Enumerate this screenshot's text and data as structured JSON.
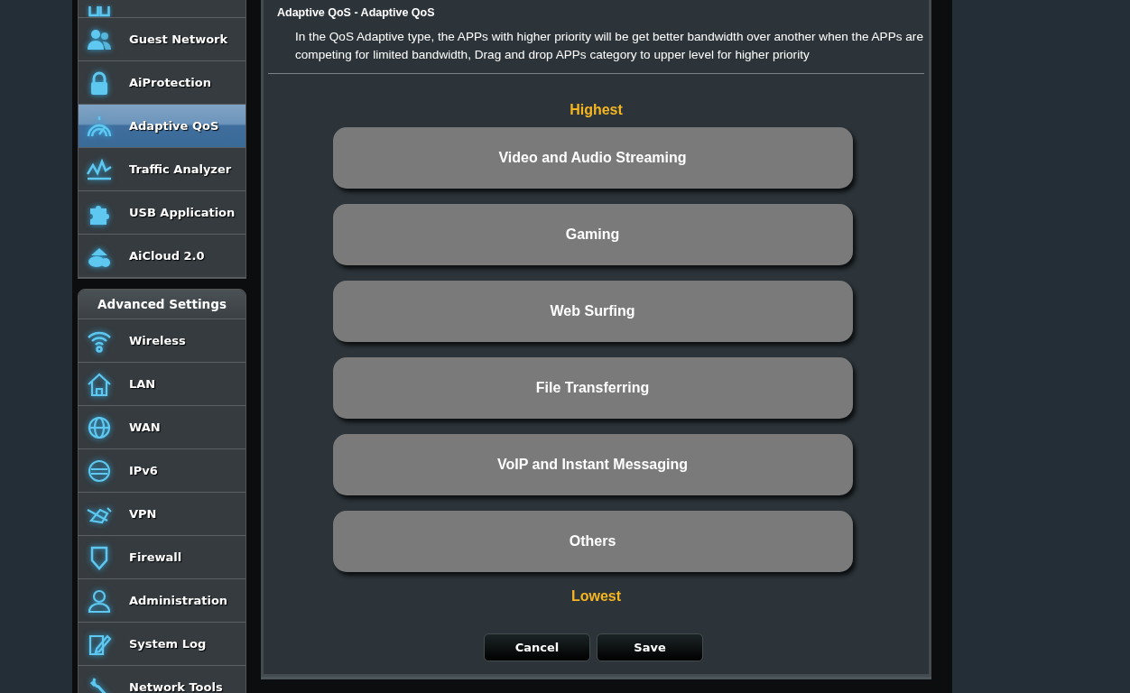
{
  "sidebar": {
    "general_items": [
      {
        "label": "Guest Network",
        "selected": false
      },
      {
        "label": "AiProtection",
        "selected": false
      },
      {
        "label": "Adaptive QoS",
        "selected": true
      },
      {
        "label": "Traffic Analyzer",
        "selected": false
      },
      {
        "label": "USB Application",
        "selected": false
      },
      {
        "label": "AiCloud 2.0",
        "selected": false
      }
    ],
    "advanced_header": "Advanced Settings",
    "advanced_items": [
      {
        "label": "Wireless",
        "selected": false
      },
      {
        "label": "LAN",
        "selected": false
      },
      {
        "label": "WAN",
        "selected": false
      },
      {
        "label": "IPv6",
        "selected": false
      },
      {
        "label": "VPN",
        "selected": false
      },
      {
        "label": "Firewall",
        "selected": false
      },
      {
        "label": "Administration",
        "selected": false
      },
      {
        "label": "System Log",
        "selected": false
      },
      {
        "label": "Network Tools",
        "selected": false
      }
    ]
  },
  "panel": {
    "title": "Adaptive QoS - Adaptive QoS",
    "description": "In the QoS Adaptive type, the APPs with higher priority will be get better bandwidth over another when the APPs are competing for limited bandwidth, Drag and drop APPs category to upper level for higher priority",
    "top_label": "Highest",
    "categories": [
      "Video and Audio Streaming",
      "Gaming",
      "Web Surfing",
      "File Transferring",
      "VoIP and Instant Messaging",
      "Others"
    ],
    "bottom_label": "Lowest",
    "buttons": [
      "Cancel",
      "Save"
    ]
  }
}
